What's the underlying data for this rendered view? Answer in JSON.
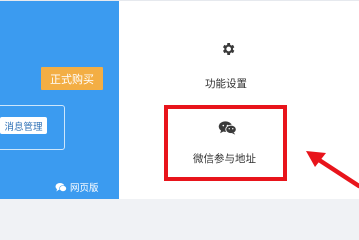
{
  "blue_panel": {
    "buy_button_label": "正式购买",
    "message_button_label": "消息管理",
    "web_version_label": "网页版",
    "background_color": "#3b9bf0",
    "buy_button_color": "#f3ae44"
  },
  "tiles": {
    "settings": {
      "label": "功能设置",
      "icon": "gear-icon"
    },
    "wechat": {
      "label": "微信参与地址",
      "icon": "wechat-icon"
    }
  },
  "annotation": {
    "highlight_color": "#e8141b",
    "arrow_icon": "arrow-icon"
  }
}
